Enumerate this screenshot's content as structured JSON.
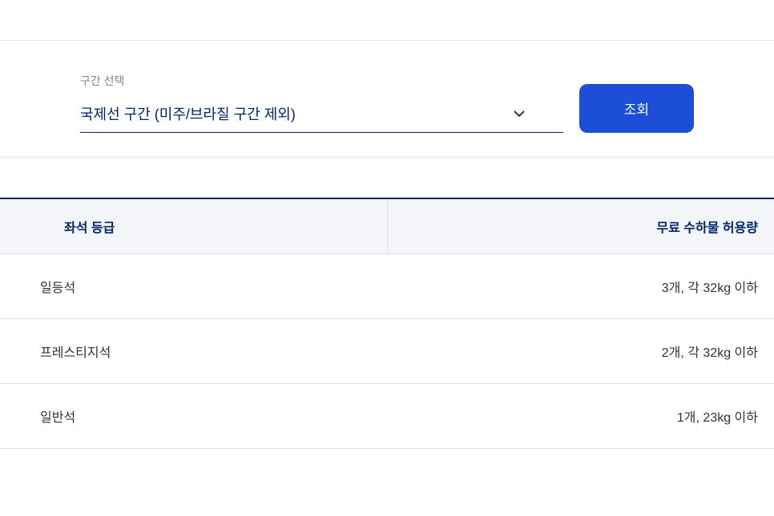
{
  "filter": {
    "label": "구간 선택",
    "selected": "국제선 구간 (미주/브라질 구간 제외)",
    "buttonLabel": "조회"
  },
  "table": {
    "headers": {
      "seatClass": "좌석 등급",
      "allowance": "무료 수하물 허용량"
    },
    "rows": [
      {
        "seatClass": "일등석",
        "allowance": "3개, 각 32kg 이하"
      },
      {
        "seatClass": "프레스티지석",
        "allowance": "2개, 각 32kg 이하"
      },
      {
        "seatClass": "일반석",
        "allowance": "1개, 23kg 이하"
      }
    ]
  }
}
